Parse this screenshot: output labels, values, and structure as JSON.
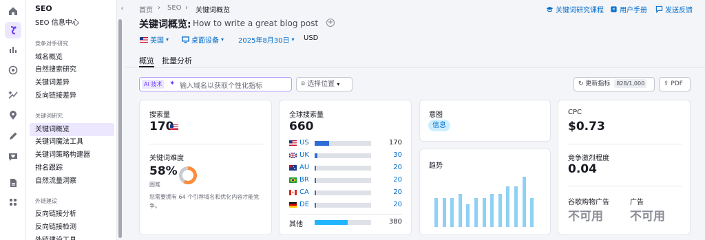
{
  "nav": {
    "title": "SEO",
    "item_seo_center": "SEO 信息中心",
    "section_competitor": "竞争对手研究",
    "competitor_items": [
      "域名概览",
      "自然搜索研究",
      "关键词差异",
      "反向链接差异"
    ],
    "section_keyword": "关键词研究",
    "keyword_items": [
      "关键词概览",
      "关键词魔法工具",
      "关键词策略构建器",
      "排名跟踪",
      "自然流量洞察"
    ],
    "section_links": "外链建设",
    "link_items": [
      "反向链接分析",
      "反向链接检测",
      "外链建设工具"
    ]
  },
  "breadcrumb": [
    "首页",
    "SEO",
    "关键词概览"
  ],
  "top_links": {
    "course": "关键词研究课程",
    "manual": "用户手册",
    "feedback": "发送反馈"
  },
  "title": {
    "label": "关键词概览:",
    "keyword": "How to write a great blog post",
    "add": "+"
  },
  "filters": {
    "country": "美国",
    "device": "桌面设备",
    "date": "2025年8月30日",
    "currency": "USD"
  },
  "tabs": [
    "概览",
    "批量分析"
  ],
  "toolbar": {
    "ai_badge": "AI 技术",
    "ai_placeholder": "输入域名以获取个性化指标",
    "location": "选择位置",
    "update_label": "更新指标",
    "update_count": "828/1,000",
    "pdf": "PDF"
  },
  "volume_card": {
    "label": "搜索量",
    "value": "170",
    "kd_label": "关键词难度",
    "kd_value": "58%",
    "kd_percent": 58,
    "kd_level": "困难",
    "kd_note_1": "您需要拥有 64 个引荐域名和优化内容才能竞",
    "kd_note_2": "争。"
  },
  "global_card": {
    "label": "全球搜索量",
    "value": "660",
    "rows": [
      {
        "code": "US",
        "value": "170",
        "share": 0.26
      },
      {
        "code": "UK",
        "value": "30",
        "share": 0.05
      },
      {
        "code": "AU",
        "value": "20",
        "share": 0.03
      },
      {
        "code": "BR",
        "value": "20",
        "share": 0.03
      },
      {
        "code": "CA",
        "value": "20",
        "share": 0.03
      },
      {
        "code": "DE",
        "value": "20",
        "share": 0.03
      }
    ],
    "other": {
      "label": "其他",
      "value": "380",
      "share": 0.58
    }
  },
  "intent_card": {
    "label": "意图",
    "value": "信息"
  },
  "trend_card": {
    "label": "趋势",
    "values": [
      0.58,
      0.58,
      0.58,
      0.66,
      0.45,
      0.58,
      0.58,
      0.66,
      0.66,
      0.81,
      0.81,
      1.0,
      0.58
    ]
  },
  "cpc_card": {
    "cpc_label": "CPC",
    "cpc_value": "$0.73",
    "comp_label": "竞争激烈程度",
    "comp_value": "0.04",
    "shopping_label": "谷歌购物广告",
    "shopping_value": "不可用",
    "ads_label": "广告",
    "ads_value": "不可用"
  },
  "colors": {
    "accent": "#006dca",
    "purple": "#6b3aff",
    "kd_orange": "#ff8c3b",
    "trend": "#8fd0f5"
  }
}
